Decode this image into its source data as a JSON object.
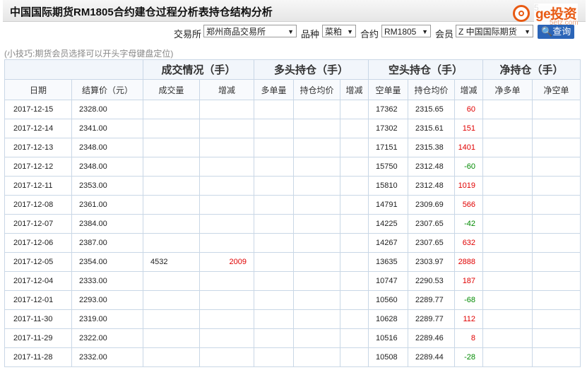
{
  "header": {
    "title": "中国国际期货RM1805合约建仓过程分析表持仓结构分析",
    "title_tail": "5",
    "logo": {
      "name": "ge投资",
      "domain": "5etz.com"
    }
  },
  "filters": {
    "exchange_label": "交易所",
    "exchange_value": "郑州商品交易所",
    "variety_label": "品种",
    "variety_value": "菜粕",
    "contract_label": "合约",
    "contract_value": "RM1805",
    "member_label": "会员",
    "member_value": "Z 中国国际期货",
    "query_label": "查询"
  },
  "tip": "(小技巧:期货会员选择可以开头字母键盘定位)",
  "table": {
    "groups": [
      "成交情况（手）",
      "多头持仓（手）",
      "空头持仓（手）",
      "净持仓（手）"
    ],
    "columns": [
      "日期",
      "结算价（元）",
      "成交量",
      "增减",
      "多单量",
      "持仓均价",
      "增减",
      "空单量",
      "持仓均价",
      "增减",
      "净多单",
      "净空单"
    ],
    "rows": [
      {
        "date": "2017-12-15",
        "price": "2328.00",
        "vol": "",
        "vol_chg": "",
        "long": "",
        "long_avg": "",
        "long_chg": "",
        "short": "17362",
        "short_avg": "2315.65",
        "short_chg": "60",
        "net_long": "",
        "net_short": ""
      },
      {
        "date": "2017-12-14",
        "price": "2341.00",
        "vol": "",
        "vol_chg": "",
        "long": "",
        "long_avg": "",
        "long_chg": "",
        "short": "17302",
        "short_avg": "2315.61",
        "short_chg": "151",
        "net_long": "",
        "net_short": ""
      },
      {
        "date": "2017-12-13",
        "price": "2348.00",
        "vol": "",
        "vol_chg": "",
        "long": "",
        "long_avg": "",
        "long_chg": "",
        "short": "17151",
        "short_avg": "2315.38",
        "short_chg": "1401",
        "net_long": "",
        "net_short": ""
      },
      {
        "date": "2017-12-12",
        "price": "2348.00",
        "vol": "",
        "vol_chg": "",
        "long": "",
        "long_avg": "",
        "long_chg": "",
        "short": "15750",
        "short_avg": "2312.48",
        "short_chg": "-60",
        "net_long": "",
        "net_short": ""
      },
      {
        "date": "2017-12-11",
        "price": "2353.00",
        "vol": "",
        "vol_chg": "",
        "long": "",
        "long_avg": "",
        "long_chg": "",
        "short": "15810",
        "short_avg": "2312.48",
        "short_chg": "1019",
        "net_long": "",
        "net_short": ""
      },
      {
        "date": "2017-12-08",
        "price": "2361.00",
        "vol": "",
        "vol_chg": "",
        "long": "",
        "long_avg": "",
        "long_chg": "",
        "short": "14791",
        "short_avg": "2309.69",
        "short_chg": "566",
        "net_long": "",
        "net_short": ""
      },
      {
        "date": "2017-12-07",
        "price": "2384.00",
        "vol": "",
        "vol_chg": "",
        "long": "",
        "long_avg": "",
        "long_chg": "",
        "short": "14225",
        "short_avg": "2307.65",
        "short_chg": "-42",
        "net_long": "",
        "net_short": ""
      },
      {
        "date": "2017-12-06",
        "price": "2387.00",
        "vol": "",
        "vol_chg": "",
        "long": "",
        "long_avg": "",
        "long_chg": "",
        "short": "14267",
        "short_avg": "2307.65",
        "short_chg": "632",
        "net_long": "",
        "net_short": ""
      },
      {
        "date": "2017-12-05",
        "price": "2354.00",
        "vol": "4532",
        "vol_chg": "2009",
        "long": "",
        "long_avg": "",
        "long_chg": "",
        "short": "13635",
        "short_avg": "2303.97",
        "short_chg": "2888",
        "net_long": "",
        "net_short": ""
      },
      {
        "date": "2017-12-04",
        "price": "2333.00",
        "vol": "",
        "vol_chg": "",
        "long": "",
        "long_avg": "",
        "long_chg": "",
        "short": "10747",
        "short_avg": "2290.53",
        "short_chg": "187",
        "net_long": "",
        "net_short": ""
      },
      {
        "date": "2017-12-01",
        "price": "2293.00",
        "vol": "",
        "vol_chg": "",
        "long": "",
        "long_avg": "",
        "long_chg": "",
        "short": "10560",
        "short_avg": "2289.77",
        "short_chg": "-68",
        "net_long": "",
        "net_short": ""
      },
      {
        "date": "2017-11-30",
        "price": "2319.00",
        "vol": "",
        "vol_chg": "",
        "long": "",
        "long_avg": "",
        "long_chg": "",
        "short": "10628",
        "short_avg": "2289.77",
        "short_chg": "112",
        "net_long": "",
        "net_short": ""
      },
      {
        "date": "2017-11-29",
        "price": "2322.00",
        "vol": "",
        "vol_chg": "",
        "long": "",
        "long_avg": "",
        "long_chg": "",
        "short": "10516",
        "short_avg": "2289.46",
        "short_chg": "8",
        "net_long": "",
        "net_short": ""
      },
      {
        "date": "2017-11-28",
        "price": "2332.00",
        "vol": "",
        "vol_chg": "",
        "long": "",
        "long_avg": "",
        "long_chg": "",
        "short": "10508",
        "short_avg": "2289.44",
        "short_chg": "-28",
        "net_long": "",
        "net_short": ""
      }
    ]
  },
  "colors": {
    "positive": "#e00000",
    "negative": "#008a00",
    "accent": "#2b65b8",
    "brand": "#e85a13"
  }
}
